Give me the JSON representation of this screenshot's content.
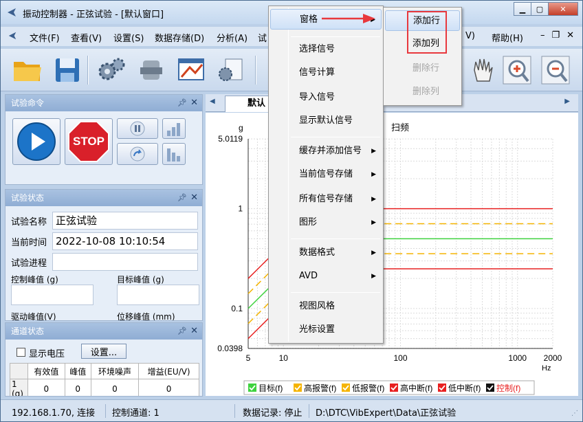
{
  "window": {
    "title": "振动控制器 - 正弦试验 - [默认窗口]"
  },
  "menu": {
    "file": "文件(F)",
    "view": "查看(V)",
    "settings": "设置(S)",
    "storage": "数据存储(D)",
    "analysis": "分析(A)",
    "test": "试",
    "hidden_v": "V)",
    "help": "帮助(H)"
  },
  "panels": {
    "commands": {
      "title": "试验命令",
      "stop_label": "STOP"
    },
    "status": {
      "title": "试验状态",
      "name_label": "试验名称",
      "name_value": "正弦试验",
      "time_label": "当前时间",
      "time_value": "2022-10-08 10:10:54",
      "progress_label": "试验进程",
      "control_peak_label": "控制峰值 (g)",
      "target_peak_label": "目标峰值 (g)",
      "drive_peak_label": "驱动峰值(V)",
      "disp_peak_label": "位移峰值 (mm)"
    },
    "channels": {
      "title": "通道状态",
      "show_voltage": "显示电压",
      "settings_button": "设置...",
      "headers": [
        "",
        "有效值",
        "峰值",
        "环境噪声",
        "增益(EU/V)"
      ],
      "rows": [
        [
          "1 (g)",
          "0",
          "0",
          "0",
          "0"
        ]
      ]
    }
  },
  "tabs": {
    "active": "默认"
  },
  "context_menu": {
    "pane": "窗格",
    "select_signal": "选择信号",
    "signal_calc": "信号计算",
    "import_signal": "导入信号",
    "show_default": "显示默认信号",
    "cache_add": "缓存并添加信号",
    "current_store": "当前信号存储",
    "all_store": "所有信号存储",
    "graphics": "图形",
    "data_format": "数据格式",
    "avd": "AVD",
    "view_style": "视图风格",
    "cursor_settings": "光标设置"
  },
  "sub_menu": {
    "add_row": "添加行",
    "add_col": "添加列",
    "del_row": "删除行",
    "del_col": "删除列"
  },
  "chart_data": {
    "type": "line",
    "title": "扫频",
    "ylabel": "g",
    "xlabel": "Hz",
    "xscale": "log",
    "yscale": "log",
    "xlim": [
      5,
      2000
    ],
    "ylim": [
      0.0398,
      5.0119
    ],
    "x_ticks": [
      "5",
      "10",
      "100",
      "1000",
      "2000"
    ],
    "y_ticks": [
      "5.0119",
      "1",
      "0.1",
      "0.0398"
    ],
    "grid": true,
    "legend_position": "bottom",
    "series": [
      {
        "name": "目标(f)",
        "color": "#3fd23f",
        "style": "solid",
        "x": [
          5,
          20,
          2000
        ],
        "y": [
          0.1,
          0.5,
          0.5
        ]
      },
      {
        "name": "高报警(f)",
        "color": "#f5b400",
        "style": "dashed",
        "x": [
          5,
          20,
          2000
        ],
        "y": [
          0.141,
          0.707,
          0.707
        ]
      },
      {
        "name": "低报警(f)",
        "color": "#f5b400",
        "style": "dashed",
        "x": [
          5,
          20,
          2000
        ],
        "y": [
          0.0707,
          0.354,
          0.354
        ]
      },
      {
        "name": "高中断(f)",
        "color": "#e82020",
        "style": "solid",
        "x": [
          5,
          20,
          2000
        ],
        "y": [
          0.2,
          1.0,
          1.0
        ]
      },
      {
        "name": "低中断(f)",
        "color": "#e82020",
        "style": "solid",
        "x": [
          5,
          20,
          2000
        ],
        "y": [
          0.05,
          0.25,
          0.25
        ]
      },
      {
        "name": "控制(f)",
        "color": "#111111",
        "style": "solid",
        "x": [],
        "y": []
      }
    ]
  },
  "statusbar": {
    "connection": "192.168.1.70, 连接",
    "control_channel": "控制通道: 1",
    "data_record": "数据记录: 停止",
    "path": "D:\\DTC\\VibExpert\\Data\\正弦试验"
  }
}
